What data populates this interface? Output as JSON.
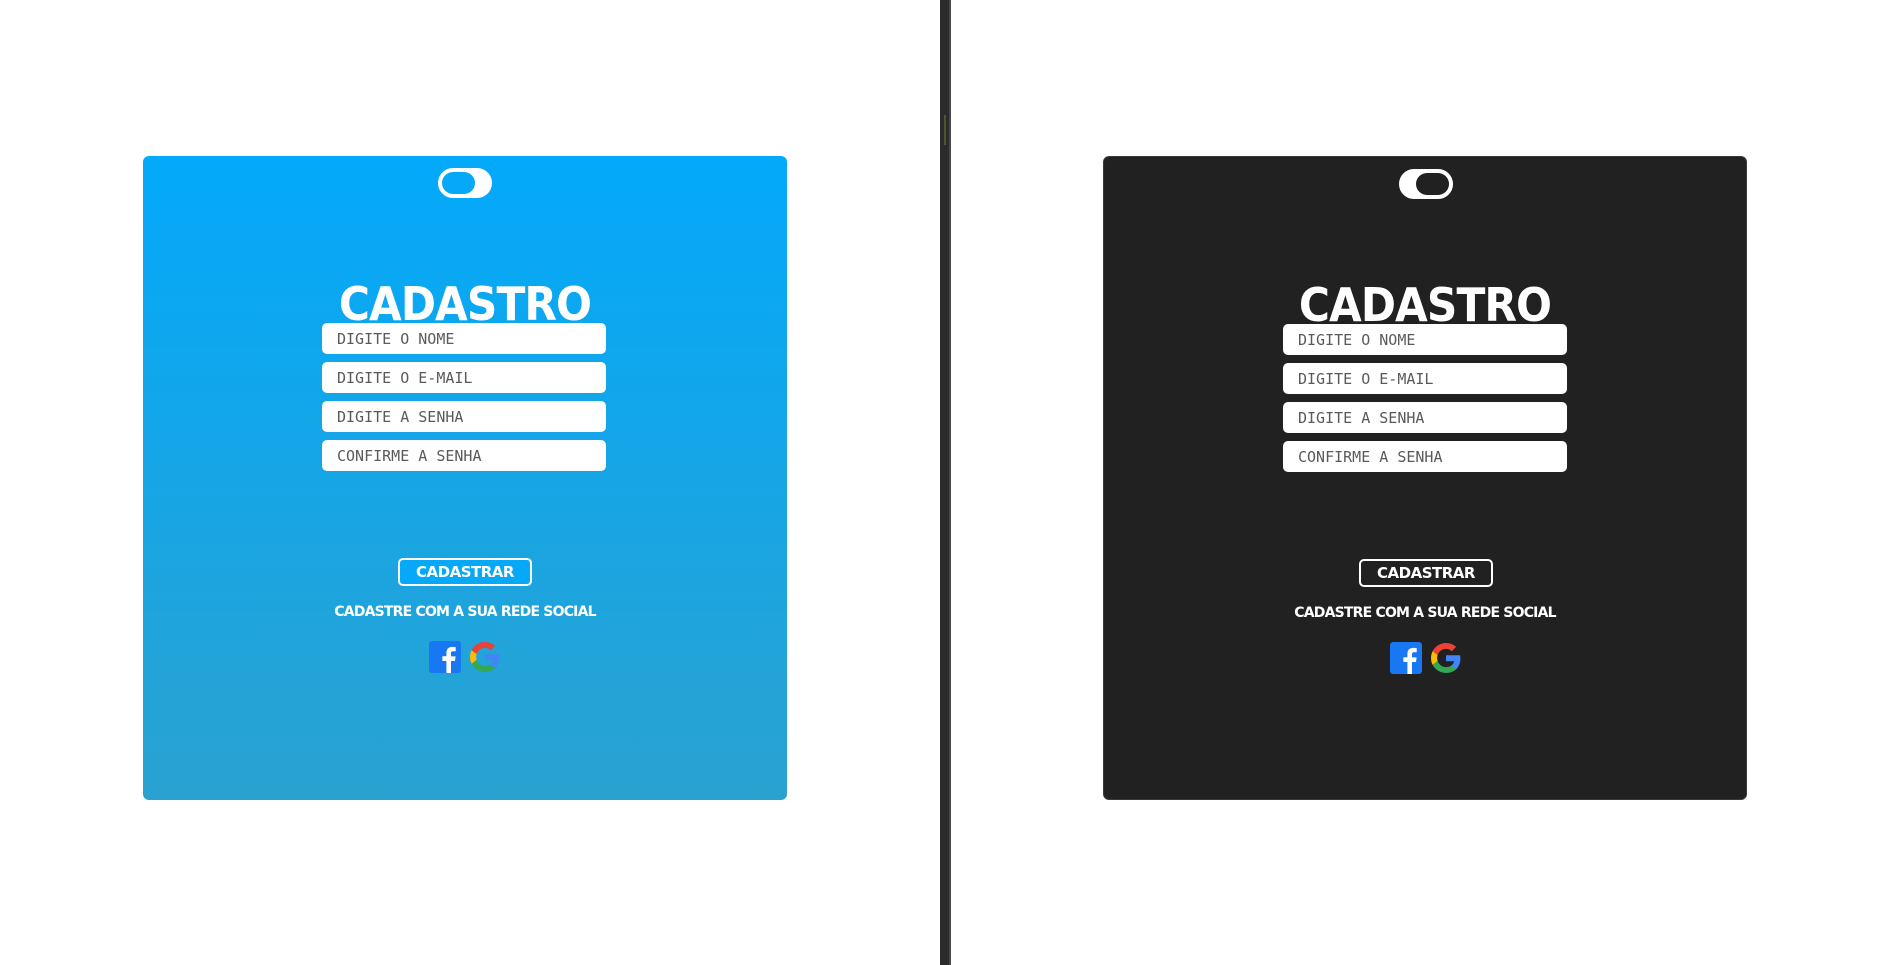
{
  "form": {
    "title": "CADASTRO",
    "fields": [
      {
        "placeholder": "DIGITE O NOME"
      },
      {
        "placeholder": "DIGITE O E-MAIL"
      },
      {
        "placeholder": "DIGITE A SENHA"
      },
      {
        "placeholder": "CONFIRME A SENHA"
      }
    ],
    "submit_label": "CADASTRAR",
    "social_text": "CADASTRE COM A SUA REDE SOCIAL",
    "social_icons": [
      "facebook-icon",
      "google-icon"
    ]
  },
  "themes": {
    "light": {
      "toggle_state": "off",
      "background": "#03a9fb"
    },
    "dark": {
      "toggle_state": "on",
      "background": "#212121"
    }
  }
}
